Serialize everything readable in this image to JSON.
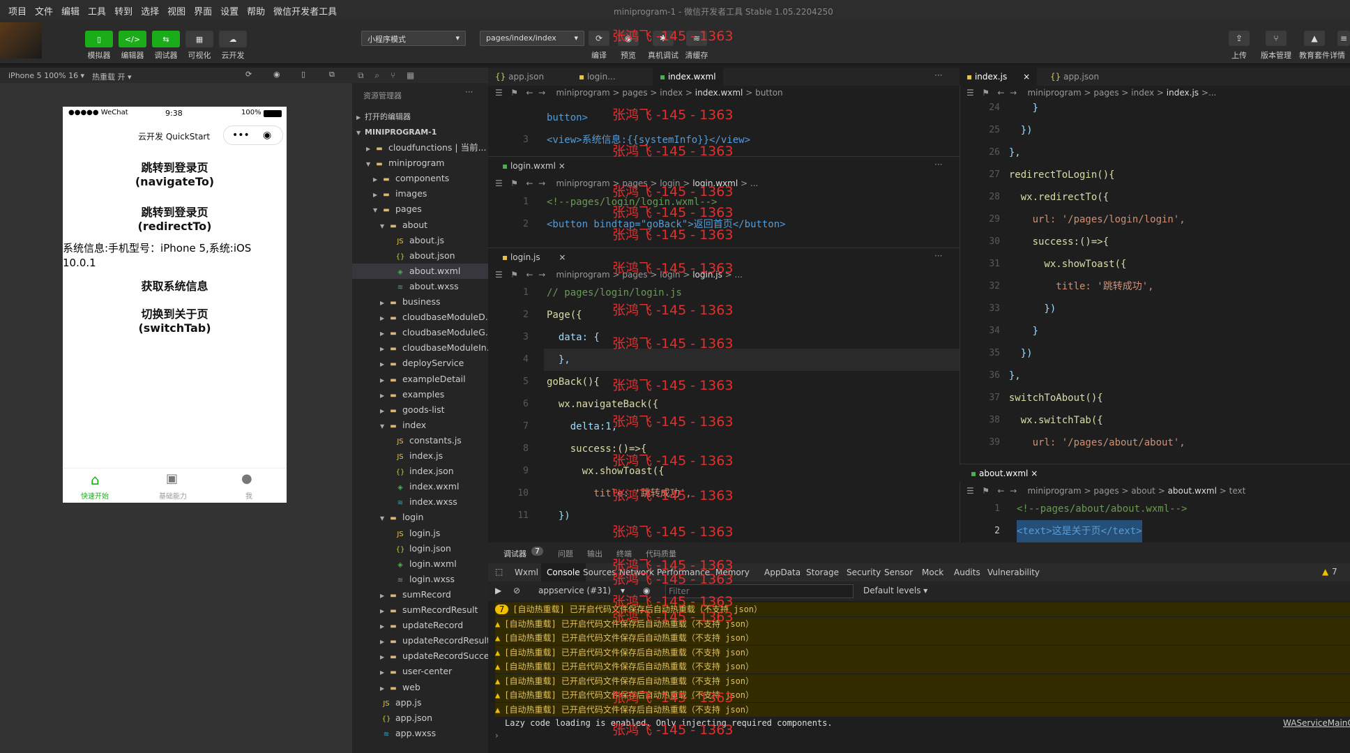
{
  "menu": [
    "项目",
    "文件",
    "编辑",
    "工具",
    "转到",
    "选择",
    "视图",
    "界面",
    "设置",
    "帮助",
    "微信开发者工具"
  ],
  "window_title": "miniprogram-1 - 微信开发者工具 Stable 1.05.2204250",
  "toolbar": {
    "left_buttons": [
      "模拟器",
      "编辑器",
      "调试器",
      "可视化",
      "云开发"
    ],
    "mode_select": "小程序模式",
    "page_select": "pages/index/index",
    "mid_labels": [
      "编译",
      "预览",
      "真机调试",
      "清缓存"
    ],
    "right_labels": [
      "上传",
      "版本管理",
      "教育套件",
      "详情"
    ]
  },
  "sim": {
    "device": "iPhone 5 100% 16 ▾",
    "hotreload": "热重载 开 ▾",
    "status_left": "●●●●● WeChat",
    "time": "9:38",
    "battery": "100%",
    "nav_title": "云开发 QuickStart",
    "btn1_line1": "跳转到登录页",
    "btn1_line2": "(navigateTo)",
    "btn2_line1": "跳转到登录页",
    "btn2_line2": "(redirectTo)",
    "sysinfo": "系统信息:手机型号：iPhone 5,系统:iOS 10.0.1",
    "btn3": "获取系统信息",
    "btn4_line1": "切换到关于页",
    "btn4_line2": "(switchTab)",
    "tab1": "快速开始",
    "tab2": "基础能力",
    "tab3": "我"
  },
  "explorer": {
    "title": "资源管理器",
    "open_editors": "打开的编辑器",
    "root": "MINIPROGRAM-1",
    "items": [
      {
        "label": "cloudfunctions | 当前...",
        "type": "fold",
        "depth": 1,
        "arrow": "right"
      },
      {
        "label": "miniprogram",
        "type": "fold",
        "depth": 1,
        "arrow": "down"
      },
      {
        "label": "components",
        "type": "fold",
        "depth": 2,
        "arrow": "right"
      },
      {
        "label": "images",
        "type": "fold",
        "depth": 2,
        "arrow": "right"
      },
      {
        "label": "pages",
        "type": "fold",
        "depth": 2,
        "arrow": "down"
      },
      {
        "label": "about",
        "type": "fold",
        "depth": 3,
        "arrow": "down"
      },
      {
        "label": "about.js",
        "type": "js",
        "depth": 4
      },
      {
        "label": "about.json",
        "type": "json",
        "depth": 4
      },
      {
        "label": "about.wxml",
        "type": "wxml",
        "depth": 4,
        "selected": true
      },
      {
        "label": "about.wxss",
        "type": "wxss",
        "depth": 4
      },
      {
        "label": "business",
        "type": "fold",
        "depth": 3,
        "arrow": "right"
      },
      {
        "label": "cloudbaseModuleD...",
        "type": "fold",
        "depth": 3,
        "arrow": "right"
      },
      {
        "label": "cloudbaseModuleG...",
        "type": "fold",
        "depth": 3,
        "arrow": "right"
      },
      {
        "label": "cloudbaseModuleIn...",
        "type": "fold",
        "depth": 3,
        "arrow": "right"
      },
      {
        "label": "deployService",
        "type": "fold",
        "depth": 3,
        "arrow": "right"
      },
      {
        "label": "exampleDetail",
        "type": "fold",
        "depth": 3,
        "arrow": "right"
      },
      {
        "label": "examples",
        "type": "fold",
        "depth": 3,
        "arrow": "right"
      },
      {
        "label": "goods-list",
        "type": "fold",
        "depth": 3,
        "arrow": "right"
      },
      {
        "label": "index",
        "type": "fold",
        "depth": 3,
        "arrow": "down"
      },
      {
        "label": "constants.js",
        "type": "js",
        "depth": 4
      },
      {
        "label": "index.js",
        "type": "js",
        "depth": 4
      },
      {
        "label": "index.json",
        "type": "json",
        "depth": 4
      },
      {
        "label": "index.wxml",
        "type": "wxml",
        "depth": 4
      },
      {
        "label": "index.wxss",
        "type": "wxss",
        "depth": 4
      },
      {
        "label": "login",
        "type": "fold",
        "depth": 3,
        "arrow": "down"
      },
      {
        "label": "login.js",
        "type": "js",
        "depth": 4
      },
      {
        "label": "login.json",
        "type": "json",
        "depth": 4
      },
      {
        "label": "login.wxml",
        "type": "wxml",
        "depth": 4
      },
      {
        "label": "login.wxss",
        "type": "wxss",
        "depth": 4
      },
      {
        "label": "sumRecord",
        "type": "fold",
        "depth": 3,
        "arrow": "right"
      },
      {
        "label": "sumRecordResult",
        "type": "fold",
        "depth": 3,
        "arrow": "right"
      },
      {
        "label": "updateRecord",
        "type": "fold",
        "depth": 3,
        "arrow": "right"
      },
      {
        "label": "updateRecordResult",
        "type": "fold",
        "depth": 3,
        "arrow": "right"
      },
      {
        "label": "updateRecordSuccess",
        "type": "fold",
        "depth": 3,
        "arrow": "right"
      },
      {
        "label": "user-center",
        "type": "fold",
        "depth": 3,
        "arrow": "right"
      },
      {
        "label": "web",
        "type": "fold",
        "depth": 3,
        "arrow": "right"
      },
      {
        "label": "app.js",
        "type": "js",
        "depth": 2
      },
      {
        "label": "app.json",
        "type": "json",
        "depth": 2
      },
      {
        "label": "app.wxss",
        "type": "wxss",
        "depth": 2
      }
    ]
  },
  "editor1": {
    "tabs": [
      "app.json",
      "login...",
      "index.wxml"
    ],
    "crumb": [
      "miniprogram",
      "pages",
      "index",
      "index.wxml",
      "button"
    ],
    "lines": [
      {
        "n": "",
        "t": "button>"
      },
      {
        "n": "3",
        "t": "<view>系统信息:{{systemInfo}}</view>"
      }
    ]
  },
  "editor2": {
    "tab": "login.wxml",
    "crumb": [
      "miniprogram",
      "pages",
      "login",
      "login.wxml",
      "..."
    ],
    "lines": [
      {
        "n": "1",
        "t": "<!--pages/login/login.wxml-->"
      },
      {
        "n": "2",
        "t": "<button bindtap=\"goBack\">返回首页</button>"
      }
    ]
  },
  "editor3": {
    "tab": "login.js",
    "crumb": [
      "miniprogram",
      "pages",
      "login",
      "login.js",
      "..."
    ],
    "lines": [
      {
        "n": "1",
        "t": "// pages/login/login.js"
      },
      {
        "n": "2",
        "t": "Page({"
      },
      {
        "n": "3",
        "t": "  data: {"
      },
      {
        "n": "4",
        "t": "  },"
      },
      {
        "n": "5",
        "t": "goBack(){"
      },
      {
        "n": "6",
        "t": "  wx.navigateBack({"
      },
      {
        "n": "7",
        "t": "    delta:1,"
      },
      {
        "n": "8",
        "t": "    success:()=>{"
      },
      {
        "n": "9",
        "t": "      wx.showToast({"
      },
      {
        "n": "10",
        "t": "        title: '跳转成功',"
      },
      {
        "n": "11",
        "t": "  })"
      }
    ]
  },
  "editor4": {
    "tabs": [
      "index.js",
      "app.json"
    ],
    "crumb": [
      "miniprogram",
      "pages",
      "index",
      "index.js",
      ">..."
    ],
    "lines": [
      {
        "n": "24",
        "t": "      }"
      },
      {
        "n": "25",
        "t": "    })"
      },
      {
        "n": "26",
        "t": "  },"
      },
      {
        "n": "27",
        "t": "  redirectToLogin(){"
      },
      {
        "n": "28",
        "t": "    wx.redirectTo({"
      },
      {
        "n": "29",
        "t": "      url: '/pages/login/login',"
      },
      {
        "n": "30",
        "t": "      success:()=>{"
      },
      {
        "n": "31",
        "t": "        wx.showToast({"
      },
      {
        "n": "32",
        "t": "          title: '跳转成功',"
      },
      {
        "n": "33",
        "t": "        })"
      },
      {
        "n": "34",
        "t": "      }"
      },
      {
        "n": "35",
        "t": "    })"
      },
      {
        "n": "36",
        "t": "  },"
      },
      {
        "n": "37",
        "t": "  switchToAbout(){"
      },
      {
        "n": "38",
        "t": "    wx.switchTab({"
      },
      {
        "n": "39",
        "t": "      url: '/pages/about/about',"
      }
    ]
  },
  "editor5": {
    "tab": "about.wxml",
    "crumb": [
      "miniprogram",
      "pages",
      "about",
      "about.wxml",
      "text"
    ],
    "lines": [
      {
        "n": "1",
        "t": "<!--pages/about/about.wxml-->"
      },
      {
        "n": "2",
        "t": "<text>这是关于页</text>"
      }
    ]
  },
  "debug": {
    "top_tabs": [
      "调试器",
      "7",
      "问题",
      "输出",
      "终端",
      "代码质量"
    ],
    "panel_tabs": [
      "Wxml",
      "Console",
      "Sources",
      "Network",
      "Performance",
      "Memory",
      "AppData",
      "Storage",
      "Security",
      "Sensor",
      "Mock",
      "Audits",
      "Vulnerability"
    ],
    "warn_count": "7",
    "context": "appservice (#31)",
    "filter_placeholder": "Filter",
    "levels": "Default levels ▾",
    "log_text": "[自动热重载] 已开启代码文件保存后自动热重载（不支持 json）",
    "info_line": "Lazy code loading is enabled. Only injecting required components.",
    "source_link": "WAServiceMainCo",
    "group_count": "7"
  },
  "watermark": "张鸿飞 -145 - 1363"
}
